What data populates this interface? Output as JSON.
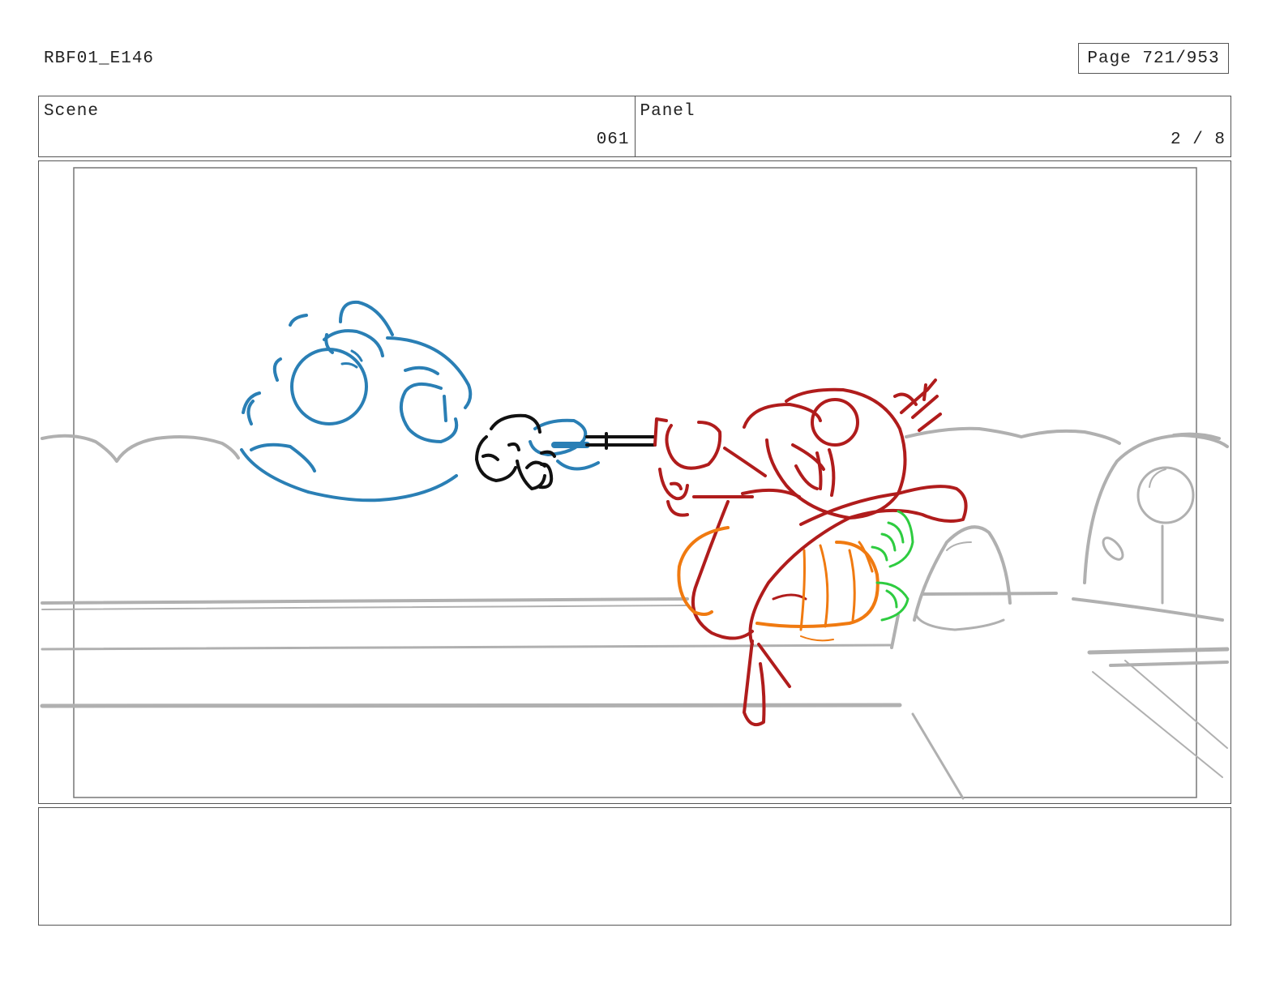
{
  "header": {
    "doc_id": "RBF01_E146",
    "page_label": "Page 721/953"
  },
  "info": {
    "scene_label": "Scene",
    "scene_value": "061",
    "panel_label": "Panel",
    "panel_value": "2 / 8"
  },
  "sketch": {
    "colors": {
      "background_lines": "#b0b0b0",
      "blue_character": "#2a7fb5",
      "red_character": "#b01c1c",
      "hand": "#111111",
      "orange_body": "#f07a10",
      "green_accent": "#2ecc40"
    }
  },
  "notes": {
    "text": ""
  }
}
